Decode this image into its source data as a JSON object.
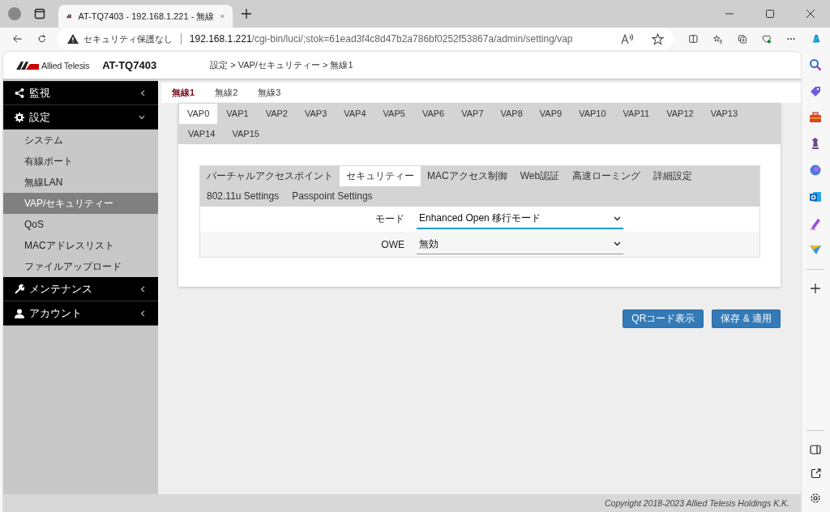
{
  "browser": {
    "tab_title": "AT-TQ7403 - 192.168.1.221 - 無線",
    "security_label": "セキュリティ保護なし",
    "url_host": "192.168.1.221",
    "url_path": "/cgi-bin/luci/;stok=61ead3f4c8d47b2a786bf0252f53867a/admin/setting/vap"
  },
  "header": {
    "brand": "Allied Telesis",
    "model": "AT-TQ7403",
    "breadcrumb": "設定 > VAP/セキュリティー > 無線1"
  },
  "sidebar": {
    "items": [
      {
        "label": "監視",
        "expanded": false
      },
      {
        "label": "設定",
        "expanded": true,
        "children": [
          {
            "label": "システム",
            "selected": false
          },
          {
            "label": "有線ポート",
            "selected": false
          },
          {
            "label": "無線LAN",
            "selected": false
          },
          {
            "label": "VAP/セキュリティー",
            "selected": true
          },
          {
            "label": "QoS",
            "selected": false
          },
          {
            "label": "MACアドレスリスト",
            "selected": false
          },
          {
            "label": "ファイルアップロード",
            "selected": false
          }
        ]
      },
      {
        "label": "メンテナンス",
        "expanded": false
      },
      {
        "label": "アカウント",
        "expanded": false
      }
    ]
  },
  "radio_tabs": [
    {
      "label": "無線1",
      "selected": true
    },
    {
      "label": "無線2",
      "selected": false
    },
    {
      "label": "無線3",
      "selected": false
    }
  ],
  "vap_tabs": [
    {
      "label": "VAP0",
      "selected": true
    },
    {
      "label": "VAP1",
      "selected": false
    },
    {
      "label": "VAP2",
      "selected": false
    },
    {
      "label": "VAP3",
      "selected": false
    },
    {
      "label": "VAP4",
      "selected": false
    },
    {
      "label": "VAP5",
      "selected": false
    },
    {
      "label": "VAP6",
      "selected": false
    },
    {
      "label": "VAP7",
      "selected": false
    },
    {
      "label": "VAP8",
      "selected": false
    },
    {
      "label": "VAP9",
      "selected": false
    },
    {
      "label": "VAP10",
      "selected": false
    },
    {
      "label": "VAP11",
      "selected": false
    },
    {
      "label": "VAP12",
      "selected": false
    },
    {
      "label": "VAP13",
      "selected": false
    },
    {
      "label": "VAP14",
      "selected": false
    },
    {
      "label": "VAP15",
      "selected": false
    }
  ],
  "section_tabs": [
    {
      "label": "バーチャルアクセスポイント",
      "selected": false
    },
    {
      "label": "セキュリティー",
      "selected": true
    },
    {
      "label": "MACアクセス制御",
      "selected": false
    },
    {
      "label": "Web認証",
      "selected": false
    },
    {
      "label": "高速ローミング",
      "selected": false
    },
    {
      "label": "詳細設定",
      "selected": false
    },
    {
      "label": "802.11u Settings",
      "selected": false
    },
    {
      "label": "Passpoint Settings",
      "selected": false
    }
  ],
  "form": [
    {
      "label": "モード",
      "value": "Enhanced Open 移行モード",
      "focused": true
    },
    {
      "label": "OWE",
      "value": "無効",
      "focused": false
    }
  ],
  "buttons": [
    "QRコード表示",
    "保存 & 適用"
  ],
  "footer": "Copyright 2018-2023 Allied Telesis Holdings K.K."
}
